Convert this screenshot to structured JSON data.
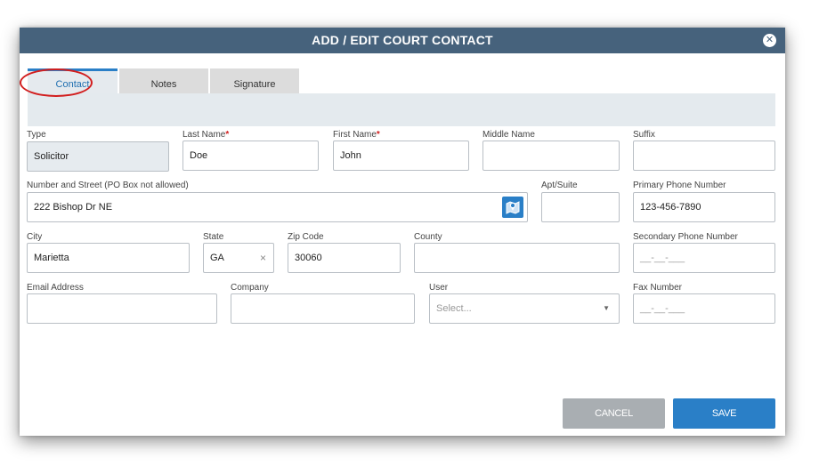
{
  "dialog": {
    "title": "ADD / EDIT COURT CONTACT",
    "close_glyph": "✕"
  },
  "tabs": [
    {
      "label": "Contact",
      "active": true
    },
    {
      "label": "Notes",
      "active": false
    },
    {
      "label": "Signature",
      "active": false
    }
  ],
  "form": {
    "type": {
      "label": "Type",
      "value": "Solicitor"
    },
    "last_name": {
      "label": "Last Name",
      "required_mark": "*",
      "value": "Doe"
    },
    "first_name": {
      "label": "First Name",
      "required_mark": "*",
      "value": "John"
    },
    "middle_name": {
      "label": "Middle Name",
      "value": ""
    },
    "suffix": {
      "label": "Suffix",
      "value": ""
    },
    "street": {
      "label": "Number and Street (PO Box not allowed)",
      "value": "222 Bishop Dr NE",
      "icon": "map-icon"
    },
    "apt_suite": {
      "label": "Apt/Suite",
      "value": ""
    },
    "primary_phone": {
      "label": "Primary Phone Number",
      "value": "123-456-7890"
    },
    "city": {
      "label": "City",
      "value": "Marietta"
    },
    "state": {
      "label": "State",
      "value": "GA",
      "clear_glyph": "×"
    },
    "zip": {
      "label": "Zip Code",
      "value": "30060"
    },
    "county": {
      "label": "County",
      "value": ""
    },
    "secondary_phone": {
      "label": "Secondary Phone Number",
      "placeholder": "__-__-___"
    },
    "email": {
      "label": "Email Address",
      "value": ""
    },
    "company": {
      "label": "Company",
      "value": ""
    },
    "user": {
      "label": "User",
      "placeholder": "Select...",
      "caret": "▼"
    },
    "fax": {
      "label": "Fax Number",
      "placeholder": "__-__-___"
    }
  },
  "buttons": {
    "cancel": "CANCEL",
    "save": "SAVE"
  },
  "colors": {
    "titlebar": "#46627c",
    "accent": "#2a7fc7",
    "required": "#d21e1e",
    "cancel": "#a9aeb2",
    "highlight_ring": "#d21e1e"
  }
}
